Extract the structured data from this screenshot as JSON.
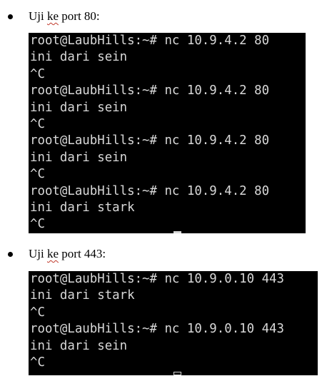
{
  "sections": [
    {
      "bullet_prefix": "Uji ",
      "bullet_marked": "ke",
      "bullet_suffix": " port 80:",
      "terminal_lines": [
        "root@LaubHills:~# nc 10.9.4.2 80",
        "ini dari sein",
        "^C",
        "root@LaubHills:~# nc 10.9.4.2 80",
        "ini dari sein",
        "^C",
        "root@LaubHills:~# nc 10.9.4.2 80",
        "ini dari sein",
        "^C",
        "root@LaubHills:~# nc 10.9.4.2 80",
        "ini dari stark",
        "^C"
      ]
    },
    {
      "bullet_prefix": "Uji ",
      "bullet_marked": "ke",
      "bullet_suffix": " port 443:",
      "terminal_lines": [
        "root@LaubHills:~# nc 10.9.0.10 443",
        "ini dari stark",
        "^C",
        "root@LaubHills:~# nc 10.9.0.10 443",
        "ini dari sein",
        "^C"
      ]
    }
  ],
  "colors": {
    "terminal_background": "#000000",
    "terminal_text": "#d8d8d8",
    "spellcheck_underline": "#c0392b"
  }
}
